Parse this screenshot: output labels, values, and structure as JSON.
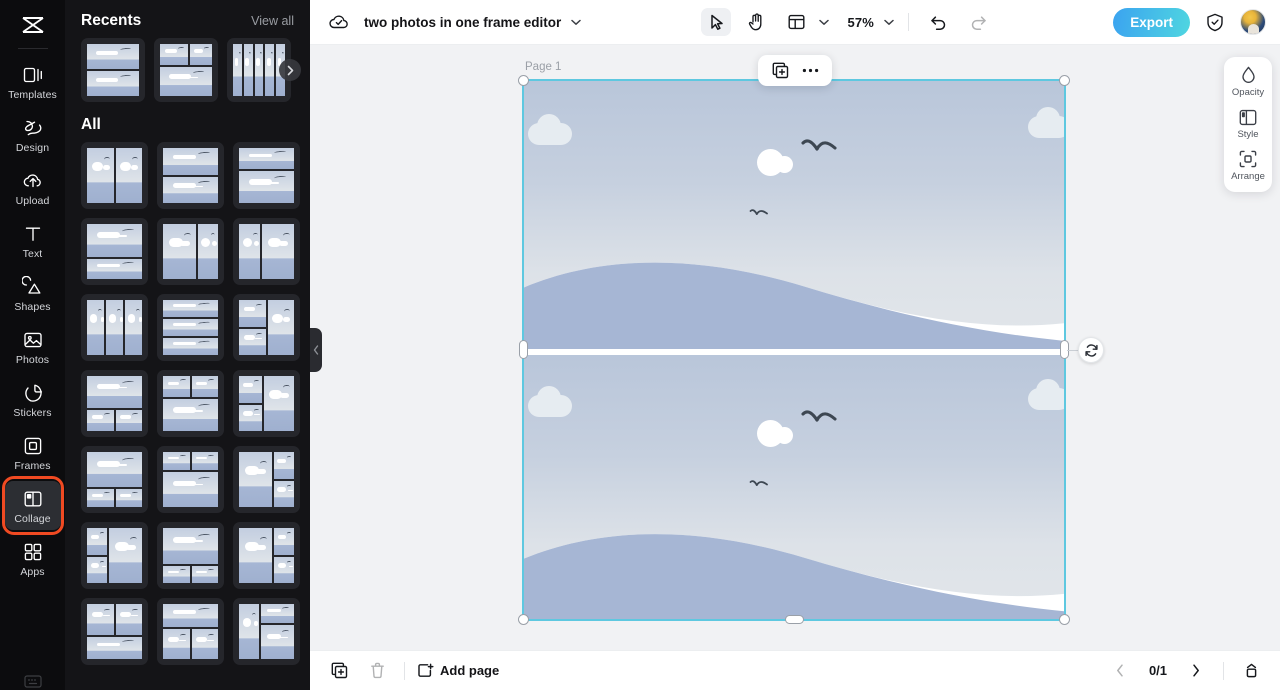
{
  "rail": {
    "logo_icon": "app-logo-icon",
    "items": [
      {
        "label": "Templates",
        "icon": "templates-icon",
        "active": false
      },
      {
        "label": "Design",
        "icon": "design-icon",
        "active": false
      },
      {
        "label": "Upload",
        "icon": "upload-icon",
        "active": false
      },
      {
        "label": "Text",
        "icon": "text-icon",
        "active": false
      },
      {
        "label": "Shapes",
        "icon": "shapes-icon",
        "active": false
      },
      {
        "label": "Photos",
        "icon": "photos-icon",
        "active": false
      },
      {
        "label": "Stickers",
        "icon": "stickers-icon",
        "active": false
      },
      {
        "label": "Frames",
        "icon": "frames-icon",
        "active": false
      },
      {
        "label": "Collage",
        "icon": "collage-icon",
        "active": true
      },
      {
        "label": "Apps",
        "icon": "apps-icon",
        "active": false
      }
    ],
    "active_highlight_color": "#f04a22"
  },
  "panel": {
    "recents_title": "Recents",
    "view_all_label": "View all",
    "all_title": "All",
    "next_arrow_icon": "chevron-right-icon",
    "collapse_icon": "chevron-left-icon",
    "recents": [
      {
        "layout": "2-rows"
      },
      {
        "layout": "1-2-split"
      },
      {
        "layout": "5-columns"
      }
    ],
    "templates": [
      {
        "layout": "2-columns"
      },
      {
        "layout": "2-rows"
      },
      {
        "layout": "2-rows-uneven"
      },
      {
        "layout": "2-rows-bottom-wide"
      },
      {
        "layout": "2-cols-uneven"
      },
      {
        "layout": "2-cols-left-wide"
      },
      {
        "layout": "3-columns"
      },
      {
        "layout": "3-rows"
      },
      {
        "layout": "left-col-right-stack"
      },
      {
        "layout": "top-wide-2-bottom"
      },
      {
        "layout": "2-top-1-bottom"
      },
      {
        "layout": "left-stack-right-col"
      },
      {
        "layout": "big-top-2-small"
      },
      {
        "layout": "2-top-big-bottom"
      },
      {
        "layout": "left-big-right-stack"
      },
      {
        "layout": "left-stack-right-big"
      },
      {
        "layout": "big-top-2-bottom-small"
      },
      {
        "layout": "left-wide-right-stack"
      },
      {
        "layout": "2-cols-1-bottom"
      },
      {
        "layout": "top-wide-2-cols"
      },
      {
        "layout": "left-narrow-right-rows"
      }
    ]
  },
  "topbar": {
    "cloud_status_icon": "cloud-check-icon",
    "document_title": "two photos in one frame editor",
    "title_chevron_icon": "chevron-down-icon",
    "tools": [
      {
        "name": "select-tool",
        "icon": "cursor-arrow-icon",
        "active": true
      },
      {
        "name": "pan-tool",
        "icon": "hand-icon",
        "active": false
      },
      {
        "name": "layout-tool",
        "icon": "layout-grid-icon",
        "active": false
      }
    ],
    "layout_chevron_icon": "chevron-down-icon",
    "zoom_level": "57%",
    "zoom_chevron_icon": "chevron-down-icon",
    "undo_icon": "undo-arrow-icon",
    "redo_icon": "redo-arrow-icon",
    "redo_disabled": true,
    "export_label": "Export",
    "export_gradient": [
      "#3ba3f0",
      "#4fd6e0"
    ],
    "shield_icon": "shield-check-icon",
    "avatar_icon": "user-avatar"
  },
  "canvas": {
    "page_label": "Page 1",
    "selection_color": "#5ec8e0",
    "context_toolbar": [
      {
        "name": "duplicate-button",
        "icon": "duplicate-layer-icon"
      },
      {
        "name": "more-options-button",
        "icon": "ellipsis-icon"
      }
    ],
    "rotate_icon": "rotate-swap-icon",
    "photos": [
      {
        "position": "top",
        "subject": "sky-with-clouds-and-hill"
      },
      {
        "position": "bottom",
        "subject": "sky-with-clouds-and-hill"
      }
    ]
  },
  "right_dock": {
    "items": [
      {
        "label": "Opacity",
        "icon": "droplet-icon"
      },
      {
        "label": "Style",
        "icon": "style-layout-icon"
      },
      {
        "label": "Arrange",
        "icon": "arrange-icon"
      }
    ]
  },
  "bottombar": {
    "duplicate_page_icon": "duplicate-page-icon",
    "delete_page_icon": "trash-icon",
    "delete_disabled": true,
    "add_page_label": "Add page",
    "add_page_icon": "add-page-icon",
    "prev_page_icon": "chevron-left-icon",
    "next_page_icon": "chevron-right-icon",
    "page_counter": "0/1",
    "pages_panel_icon": "pages-panel-icon"
  }
}
